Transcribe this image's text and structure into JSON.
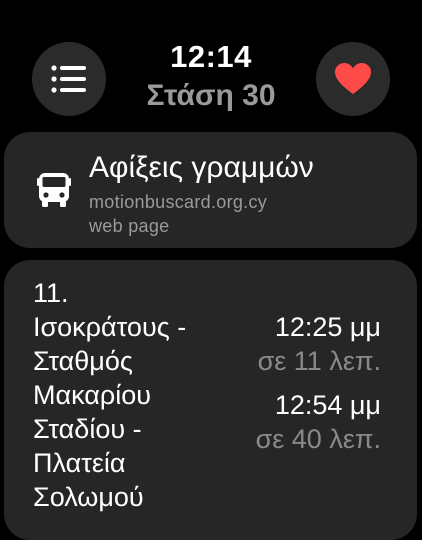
{
  "header": {
    "time": "12:14",
    "stop_title": "Στάση 30"
  },
  "buttons": {
    "menu_icon": "list-icon",
    "favorite_icon": "heart-icon",
    "favorite_color": "#ff4a4a"
  },
  "link_card": {
    "icon": "bus-icon",
    "title": "Αφίξεις γραμμών",
    "domain": "motionbuscard.org.cy",
    "kind": "web page"
  },
  "route_card": {
    "number": "11.",
    "name_lines": [
      "Ισοκράτους -",
      "Σταθμός",
      "Μακαρίου",
      "Σταδίου -",
      "Πλατεία",
      "Σολωμού"
    ],
    "arrivals": [
      {
        "time": "12:25 μμ",
        "eta": "σε 11 λεπ."
      },
      {
        "time": "12:54 μμ",
        "eta": "σε 40 λεπ."
      }
    ]
  }
}
